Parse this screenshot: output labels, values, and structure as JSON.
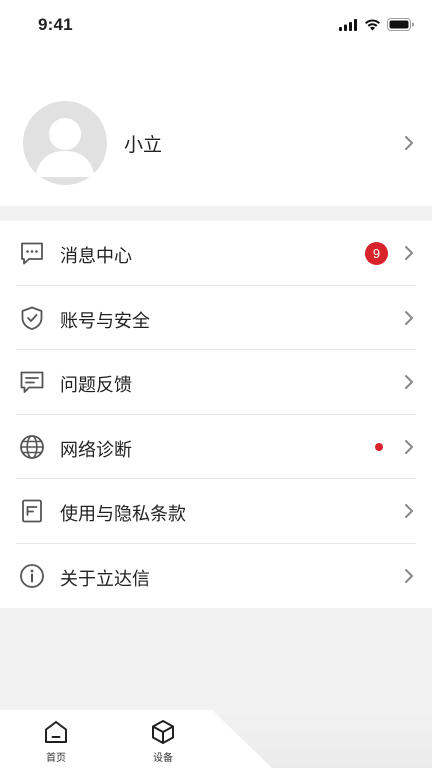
{
  "status": {
    "time": "9:41"
  },
  "profile": {
    "name": "小立"
  },
  "menu": {
    "items": [
      {
        "label": "消息中心",
        "icon": "message-icon",
        "badge": "9"
      },
      {
        "label": "账号与安全",
        "icon": "shield-check-icon"
      },
      {
        "label": "问题反馈",
        "icon": "feedback-icon"
      },
      {
        "label": "网络诊断",
        "icon": "globe-icon",
        "dot": true
      },
      {
        "label": "使用与隐私条款",
        "icon": "document-icon"
      },
      {
        "label": "关于立达信",
        "icon": "info-icon"
      }
    ]
  },
  "tabs": [
    {
      "label": "首页",
      "icon": "home-icon"
    },
    {
      "label": "设备",
      "icon": "cube-icon"
    }
  ],
  "colors": {
    "badge": "#d8232a",
    "accent": "#333333"
  }
}
